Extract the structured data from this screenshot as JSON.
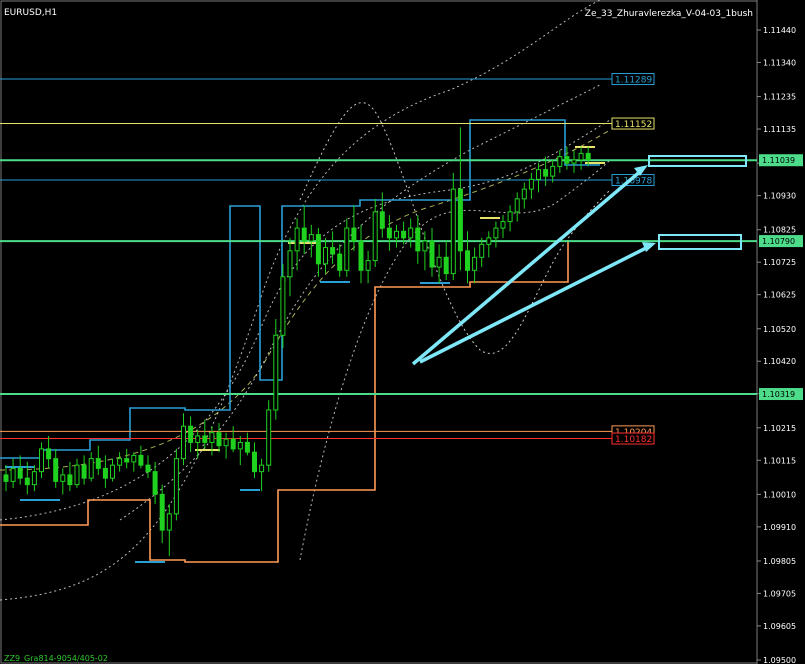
{
  "header": {
    "symbol": "EURUSD,H1",
    "indicator": "Ze_33_Zhuravlerezka_V-04-03_1bush"
  },
  "footer": {
    "label": "ZZ9_Gra814-9054/405-02"
  },
  "colors": {
    "background": "#000000",
    "candle": "#1fd21f",
    "price_line": "#00ff66",
    "blue_level": "#2a9fd6",
    "yellow_level": "#e6e26a",
    "orange_level": "#ff9a55",
    "red_level": "#ff3030",
    "mint_level": "#4ddc8a",
    "arrow": "#7fe8f8"
  },
  "chart_data": {
    "type": "candlestick",
    "symbol": "EURUSD",
    "timeframe": "H1",
    "ylim": [
      1.0955,
      1.115
    ],
    "y_ticks": [
      "1.11440",
      "1.11340",
      "1.11235",
      "1.11135",
      "1.11030",
      "1.10930",
      "1.10825",
      "1.10725",
      "1.10625",
      "1.10520",
      "1.10420",
      "1.10320",
      "1.10215",
      "1.10115",
      "1.10010",
      "1.09910",
      "1.09805",
      "1.09705",
      "1.09605",
      "1.09500"
    ],
    "level_labels": [
      {
        "value": "1.11289",
        "color": "#2a9fd6"
      },
      {
        "value": "1.11152",
        "color": "#e6e26a"
      },
      {
        "value": "1.10978",
        "color": "#2a9fd6"
      },
      {
        "value": "1.10204",
        "color": "#ff9a55"
      },
      {
        "value": "1.10182",
        "color": "#ff3030"
      }
    ],
    "axis_labels": [
      {
        "value": "1.11039",
        "color": "#4ddc8a"
      },
      {
        "value": "1.10790",
        "color": "#4ddc8a"
      },
      {
        "value": "1.10319",
        "color": "#4ddc8a"
      }
    ],
    "levels": [
      {
        "price": 1.11289,
        "color": "#2a9fd6"
      },
      {
        "price": 1.11152,
        "color": "#e6e26a"
      },
      {
        "price": 1.10978,
        "color": "#2a9fd6"
      },
      {
        "price": 1.11039,
        "color": "#4ddc8a",
        "thick": true
      },
      {
        "price": 1.1079,
        "color": "#4ddc8a",
        "thick": true
      },
      {
        "price": 1.10319,
        "color": "#4ddc8a",
        "thick": true
      },
      {
        "price": 1.10204,
        "color": "#ff9a55"
      },
      {
        "price": 1.10182,
        "color": "#ff3030"
      }
    ],
    "candles": [
      [
        1.1007,
        1.101,
        1.1002,
        1.1005
      ],
      [
        1.1005,
        1.1012,
        1.1003,
        1.1009
      ],
      [
        1.1009,
        1.1013,
        1.1004,
        1.1006
      ],
      [
        1.1006,
        1.1011,
        1.1001,
        1.1004
      ],
      [
        1.1004,
        1.101,
        1.1002,
        1.1008
      ],
      [
        1.1008,
        1.1017,
        1.1006,
        1.1015
      ],
      [
        1.1015,
        1.1019,
        1.1009,
        1.1012
      ],
      [
        1.1012,
        1.1015,
        1.1003,
        1.1005
      ],
      [
        1.1005,
        1.1009,
        1.1001,
        1.1007
      ],
      [
        1.1007,
        1.1011,
        1.1002,
        1.1004
      ],
      [
        1.1004,
        1.1012,
        1.1003,
        1.101
      ],
      [
        1.101,
        1.1013,
        1.1004,
        1.1006
      ],
      [
        1.1006,
        1.1014,
        1.1005,
        1.1012
      ],
      [
        1.1012,
        1.1016,
        1.1007,
        1.1009
      ],
      [
        1.1009,
        1.1013,
        1.1003,
        1.1006
      ],
      [
        1.1006,
        1.1012,
        1.1005,
        1.101
      ],
      [
        1.101,
        1.1014,
        1.1008,
        1.1012
      ],
      [
        1.1012,
        1.1015,
        1.1009,
        1.1011
      ],
      [
        1.1011,
        1.1014,
        1.1008,
        1.1013
      ],
      [
        1.1013,
        1.1016,
        1.1009,
        1.101
      ],
      [
        1.101,
        1.1013,
        1.1006,
        1.1008
      ],
      [
        1.1008,
        1.1011,
        1.0998,
        1.1001
      ],
      [
        1.1001,
        1.1004,
        1.0986,
        1.099
      ],
      [
        1.099,
        1.0998,
        1.0982,
        1.0995
      ],
      [
        1.0995,
        1.1015,
        1.0993,
        1.1012
      ],
      [
        1.1012,
        1.1026,
        1.101,
        1.1022
      ],
      [
        1.1022,
        1.1025,
        1.1014,
        1.1017
      ],
      [
        1.1017,
        1.1021,
        1.1012,
        1.1019
      ],
      [
        1.1019,
        1.1024,
        1.1015,
        1.1017
      ],
      [
        1.1017,
        1.1022,
        1.1013,
        1.102
      ],
      [
        1.102,
        1.1023,
        1.1014,
        1.1016
      ],
      [
        1.1016,
        1.102,
        1.1012,
        1.1018
      ],
      [
        1.1018,
        1.1022,
        1.1014,
        1.1015
      ],
      [
        1.1015,
        1.1019,
        1.101,
        1.1017
      ],
      [
        1.1017,
        1.102,
        1.1013,
        1.1014
      ],
      [
        1.1014,
        1.1017,
        1.1006,
        1.1008
      ],
      [
        1.1008,
        1.1012,
        1.1002,
        1.101
      ],
      [
        1.101,
        1.103,
        1.1008,
        1.1027
      ],
      [
        1.1027,
        1.1055,
        1.1024,
        1.105
      ],
      [
        1.105,
        1.1072,
        1.1046,
        1.1068
      ],
      [
        1.1068,
        1.108,
        1.1062,
        1.1076
      ],
      [
        1.1076,
        1.1086,
        1.107,
        1.1083
      ],
      [
        1.1083,
        1.109,
        1.1075,
        1.1079
      ],
      [
        1.1079,
        1.1084,
        1.1074,
        1.1081
      ],
      [
        1.1081,
        1.1083,
        1.1068,
        1.1072
      ],
      [
        1.1072,
        1.108,
        1.1069,
        1.1077
      ],
      [
        1.1077,
        1.1082,
        1.1072,
        1.1075
      ],
      [
        1.1075,
        1.1078,
        1.1068,
        1.107
      ],
      [
        1.107,
        1.1086,
        1.1068,
        1.1083
      ],
      [
        1.1083,
        1.109,
        1.1076,
        1.1079
      ],
      [
        1.1079,
        1.1084,
        1.1066,
        1.107
      ],
      [
        1.107,
        1.1076,
        1.1066,
        1.1073
      ],
      [
        1.1073,
        1.1092,
        1.1071,
        1.1088
      ],
      [
        1.1088,
        1.1094,
        1.108,
        1.1083
      ],
      [
        1.1083,
        1.1087,
        1.1076,
        1.108
      ],
      [
        1.108,
        1.1084,
        1.1077,
        1.1082
      ],
      [
        1.1082,
        1.1085,
        1.1078,
        1.108
      ],
      [
        1.108,
        1.1086,
        1.1077,
        1.1083
      ],
      [
        1.1083,
        1.1087,
        1.1072,
        1.1076
      ],
      [
        1.1076,
        1.1082,
        1.107,
        1.1079
      ],
      [
        1.1079,
        1.1083,
        1.1068,
        1.1071
      ],
      [
        1.1071,
        1.1078,
        1.1066,
        1.1074
      ],
      [
        1.1074,
        1.1079,
        1.1067,
        1.1069
      ],
      [
        1.1069,
        1.11,
        1.1067,
        1.1095
      ],
      [
        1.1095,
        1.1114,
        1.107,
        1.1076
      ],
      [
        1.1076,
        1.1082,
        1.1066,
        1.107
      ],
      [
        1.107,
        1.1077,
        1.1066,
        1.1074
      ],
      [
        1.1074,
        1.108,
        1.1071,
        1.1078
      ],
      [
        1.1078,
        1.1082,
        1.1074,
        1.108
      ],
      [
        1.108,
        1.1085,
        1.1077,
        1.1083
      ],
      [
        1.1083,
        1.1087,
        1.108,
        1.1085
      ],
      [
        1.1085,
        1.109,
        1.1082,
        1.1088
      ],
      [
        1.1088,
        1.1094,
        1.1085,
        1.1092
      ],
      [
        1.1092,
        1.1097,
        1.1089,
        1.1095
      ],
      [
        1.1095,
        1.11,
        1.1092,
        1.1098
      ],
      [
        1.1098,
        1.1103,
        1.1094,
        1.1101
      ],
      [
        1.1101,
        1.1105,
        1.1096,
        1.1099
      ],
      [
        1.1099,
        1.1104,
        1.1097,
        1.1102
      ],
      [
        1.1102,
        1.1107,
        1.11,
        1.1105
      ],
      [
        1.1105,
        1.1108,
        1.1101,
        1.1103
      ],
      [
        1.1103,
        1.1107,
        1.11,
        1.1104
      ],
      [
        1.1104,
        1.1108,
        1.1101,
        1.1106
      ],
      [
        1.1106,
        1.1108,
        1.1102,
        1.1104
      ]
    ]
  }
}
